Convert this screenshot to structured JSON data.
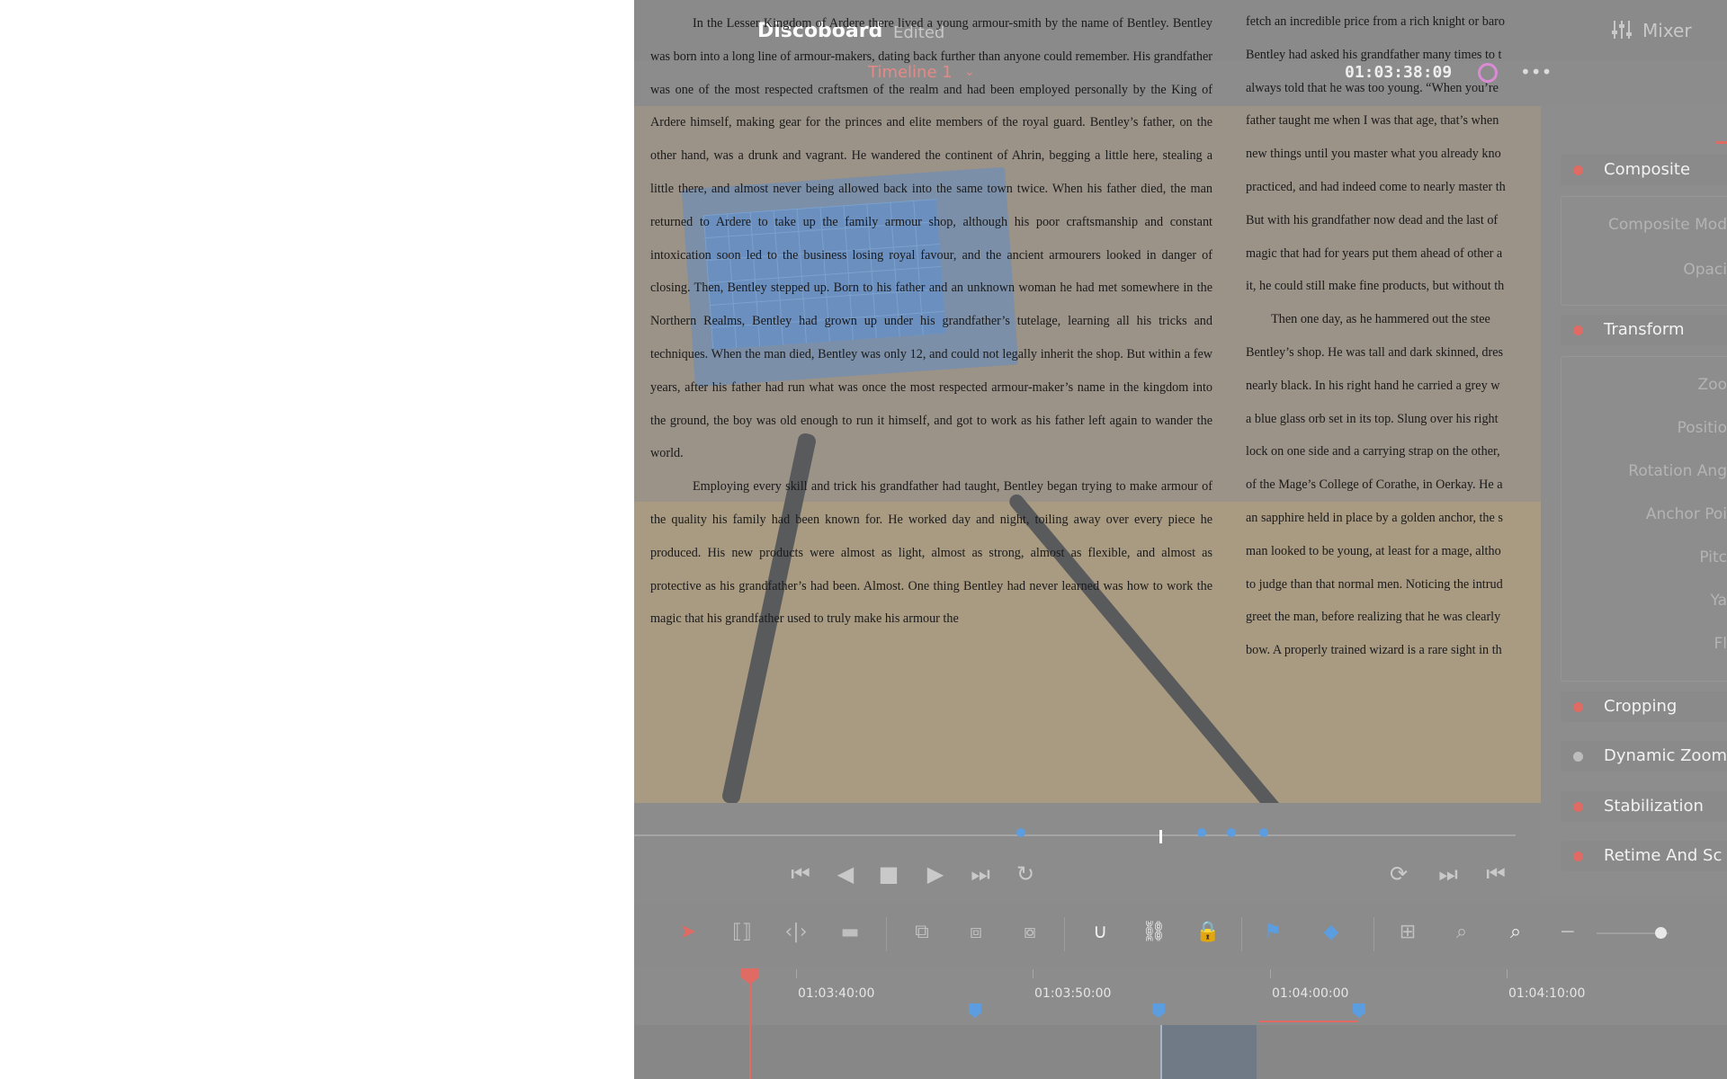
{
  "app": {
    "project_title": "Discoboard",
    "status": "Edited",
    "mixer_label": "Mixer",
    "timeline_name": "Timeline 1",
    "timecode": "01:03:38:09"
  },
  "document_text": {
    "col1_paragraphs": [
      "In the Lesser Kingdom of Ardere there lived a young armour-smith by the name of Bentley. Bentley was born into a long line of armour-makers, dating back further than anyone could remember. His grandfather was one of the most respected craftsmen of the realm and had been employed personally by the King of Ardere himself, making gear for the princes and elite members of the royal guard. Bentley’s father, on the other hand, was a drunk and vagrant. He wandered the continent of Ahrin, begging a little here, stealing a little there, and almost never being allowed back into the same town twice. When his father died, the man returned to Ardere to take up the family armour shop, although his poor craftsmanship and constant intoxication soon led to the business losing royal favour, and the ancient armourers looked in danger of closing. Then, Bentley stepped up. Born to his father and an unknown woman he had met somewhere in the Northern Realms, Bentley had grown up under his grandfather’s tutelage, learning all his tricks and techniques. When the man died, Bentley was only 12, and could not legally inherit the shop. But within a few years, after his father had run what was once the most respected armour-maker’s name in the kingdom into the ground, the boy was old enough to run it himself, and got to work as his father left again to wander the world.",
      "Employing every skill and trick his grandfather had taught, Bentley began trying to make armour of the quality his family had been known for. He worked day and night, toiling away over every piece he produced. His new products were almost as light, almost as strong, almost as flexible, and almost as protective as his grandfather’s had been. Almost. One thing Bentley had never learned was how to work the magic that his grandfather used to truly make his armour the"
    ],
    "col2_lines": [
      "fetch an incredible price from a rich knight or baro",
      "Bentley had asked his grandfather many times to t",
      "always told that he was too young. “When you’re",
      "father taught me when I was that age, that’s when",
      "new things until you master what you already kno",
      "practiced, and had indeed come to nearly master th",
      "But with his grandfather now dead and the last of",
      "magic that had for years put them ahead of other a",
      "it, he could still make fine products, but without th",
      "        Then one day, as he hammered out the stee",
      "Bentley’s shop. He was tall and dark skinned, dres",
      "nearly black. In his right hand he carried a grey w",
      "a blue glass orb set in its top. Slung over his right",
      "lock on one side and a carrying strap on the other,",
      "of the Mage’s College of Corathe, in Oerkay. He a",
      "an sapphire held in place by a golden anchor, the s",
      "man looked to be young, at least for a mage, altho",
      "to judge than that normal men. Noticing the intrud",
      "greet the man, before realizing that he was clearly",
      "bow. A properly trained wizard is a rare sight in th"
    ]
  },
  "inspector": {
    "sections": [
      {
        "label": "Composite",
        "enabled": true
      },
      {
        "label": "Transform",
        "enabled": true
      },
      {
        "label": "Cropping",
        "enabled": true
      },
      {
        "label": "Dynamic Zoom",
        "enabled": false
      },
      {
        "label": "Stabilization",
        "enabled": true
      },
      {
        "label": "Retime And Sc",
        "enabled": true
      }
    ],
    "composite_props": [
      "Composite Mod",
      "Opaci"
    ],
    "transform_props": [
      "Zoo",
      "Positio",
      "Rotation Ang",
      "Anchor Poi",
      "Pitc",
      "Ya",
      "Fl"
    ]
  },
  "ruler": {
    "labels": [
      "01:03:40:00",
      "01:03:50:00",
      "01:04:00:00",
      "01:04:10:00"
    ]
  },
  "icons": {
    "transport": [
      "skip-to-start-icon",
      "play-reverse-icon",
      "stop-icon",
      "play-icon",
      "skip-to-end-icon",
      "loop-icon"
    ],
    "transport_right": [
      "match-frame-icon",
      "next-edit-icon",
      "prev-edit-icon"
    ],
    "tools": [
      "selection-tool-icon",
      "trim-tool-icon",
      "dynamic-trim-icon",
      "blade-tool-icon",
      "insert-clip-icon",
      "overwrite-clip-icon",
      "replace-clip-icon",
      "snapping-icon",
      "linked-selection-icon",
      "lock-icon",
      "flag-icon",
      "marker-icon",
      "full-extent-zoom-icon",
      "detail-zoom-icon",
      "custom-zoom-icon",
      "zoom-out-icon"
    ]
  },
  "colors": {
    "accent_red": "#e06a64",
    "marker_blue": "#5c9ddf",
    "timeline_title": "#e48a86"
  }
}
